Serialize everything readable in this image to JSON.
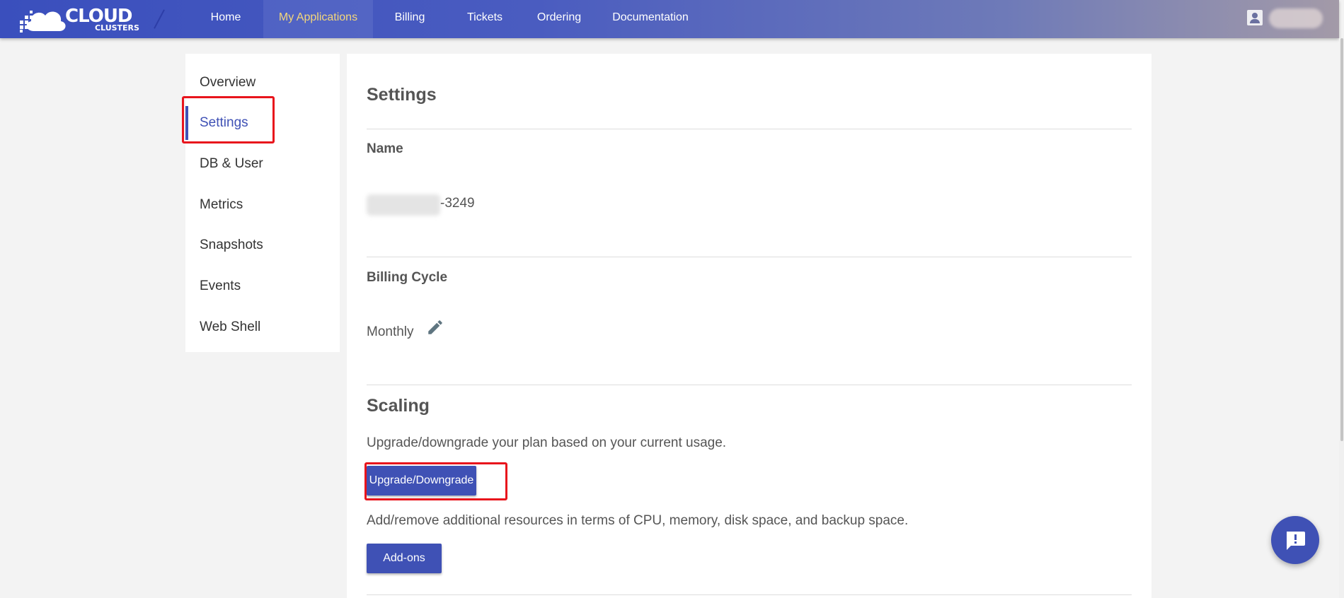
{
  "brand": {
    "name_main": "CLOUD",
    "name_sub": "CLUSTERS"
  },
  "nav": {
    "items": [
      {
        "label": "Home"
      },
      {
        "label": "My Applications",
        "active": true
      },
      {
        "label": "Billing"
      },
      {
        "label": "Tickets"
      },
      {
        "label": "Ordering"
      },
      {
        "label": "Documentation"
      }
    ]
  },
  "sidebar": {
    "items": [
      {
        "label": "Overview"
      },
      {
        "label": "Settings",
        "active": true
      },
      {
        "label": "DB & User"
      },
      {
        "label": "Metrics"
      },
      {
        "label": "Snapshots"
      },
      {
        "label": "Events"
      },
      {
        "label": "Web Shell"
      }
    ]
  },
  "settings": {
    "title": "Settings",
    "name_label": "Name",
    "name_suffix": "-3249",
    "billing_label": "Billing Cycle",
    "billing_value": "Monthly"
  },
  "scaling": {
    "title": "Scaling",
    "upgrade_desc": "Upgrade/downgrade your plan based on your current usage.",
    "upgrade_button": "Upgrade/Downgrade",
    "addons_desc": "Add/remove additional resources in terms of CPU, memory, disk space, and backup space.",
    "addons_button": "Add-ons"
  },
  "colors": {
    "accent": "#3f51b5",
    "highlight": "#e8141c",
    "nav_active_text": "#f4d77a"
  },
  "icons": {
    "logo": "cloud-logo-icon",
    "user": "account-box-icon",
    "edit": "pencil-icon",
    "chat": "chat-feedback-icon"
  }
}
